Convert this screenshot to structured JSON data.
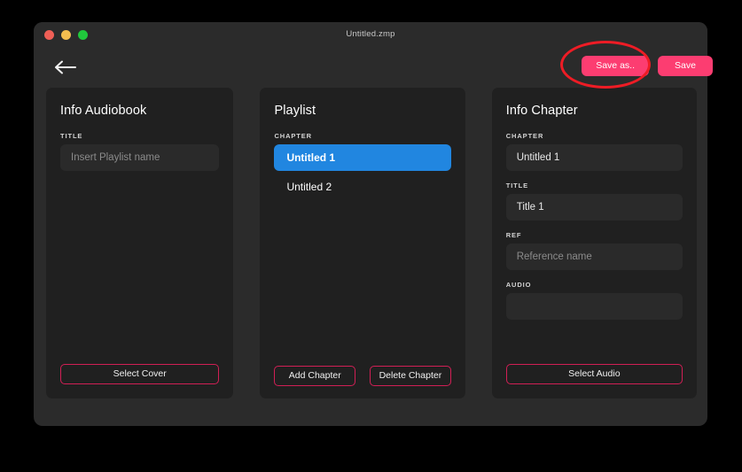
{
  "window": {
    "title": "Untitled.zmp",
    "traffic_lights": [
      {
        "name": "close-button",
        "color": "#ef5f56"
      },
      {
        "name": "minimize-button",
        "color": "#f4bd4f"
      },
      {
        "name": "maximize-button",
        "color": "#20c83c"
      }
    ]
  },
  "toolbar": {
    "back_icon": "arrow-left-icon",
    "save_as_label": "Save as..",
    "save_label": "Save",
    "accent_color": "#fc3d71"
  },
  "annotation": {
    "shape": "ellipse",
    "color": "#ee1c25",
    "target": "Save as.. button"
  },
  "panels": {
    "info_audiobook": {
      "title": "Info Audiobook",
      "title_label": "TITLE",
      "title_placeholder": "Insert Playlist name",
      "title_value": "",
      "select_cover_label": "Select Cover"
    },
    "playlist": {
      "title": "Playlist",
      "chapter_label": "CHAPTER",
      "chapters": [
        {
          "label": "Untitled 1",
          "selected": true
        },
        {
          "label": "Untitled 2",
          "selected": false
        }
      ],
      "selected_color": "#2186e0",
      "add_chapter_label": "Add Chapter",
      "delete_chapter_label": "Delete Chapter"
    },
    "info_chapter": {
      "title": "Info Chapter",
      "chapter_label": "CHAPTER",
      "chapter_value": "Untitled 1",
      "title_label": "TITLE",
      "title_value": "Title 1",
      "ref_label": "REF",
      "ref_placeholder": "Reference name",
      "ref_value": "",
      "audio_label": "AUDIO",
      "audio_value": "",
      "select_audio_label": "Select Audio"
    }
  },
  "theme": {
    "outline_button_border": "#d11f55",
    "panel_bg": "#202020",
    "window_bg": "#2b2b2b"
  }
}
